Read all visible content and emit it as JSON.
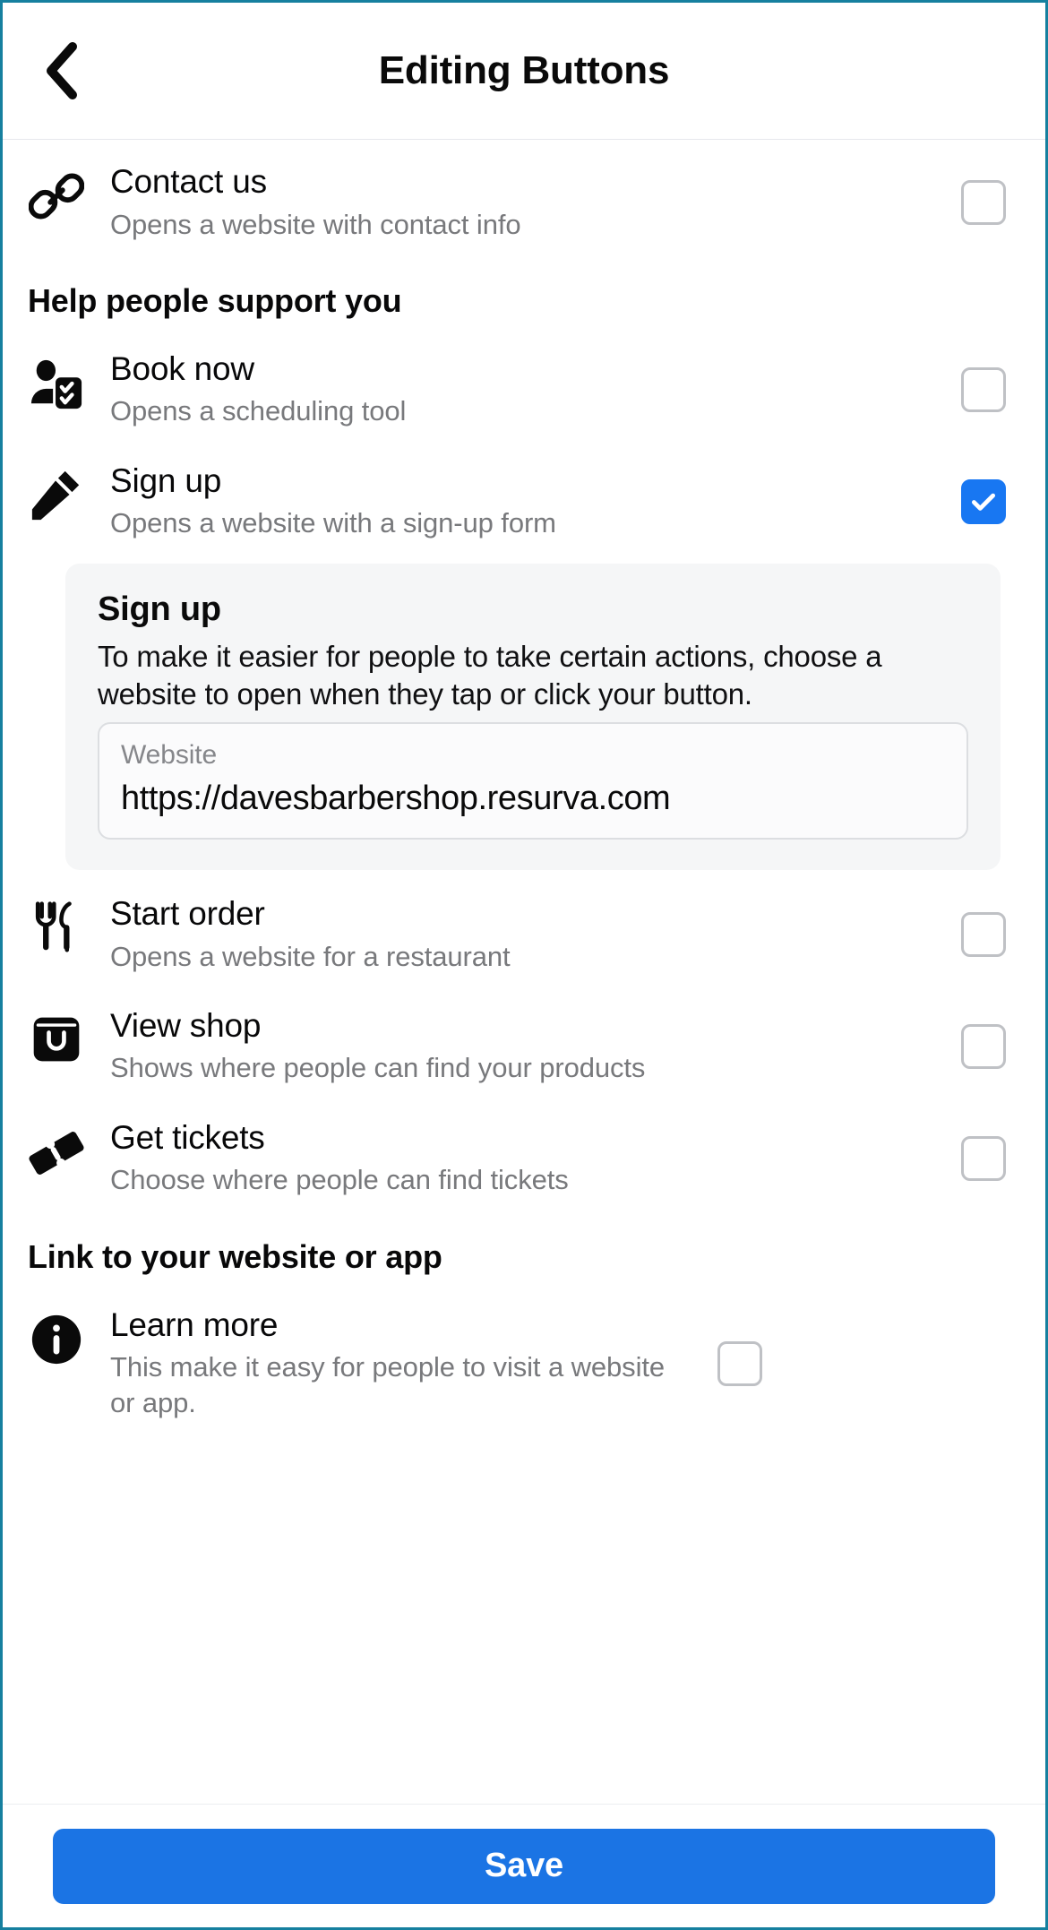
{
  "header": {
    "title": "Editing Buttons",
    "back_icon": "chevron-left-icon"
  },
  "sections": [
    {
      "id": "top-partial",
      "heading": null,
      "rows": [
        {
          "id": "contact-us",
          "icon": "link-icon",
          "title": "Contact us",
          "subtitle": "Opens a website with contact info",
          "checked": false
        }
      ]
    },
    {
      "id": "support",
      "heading": "Help people support you",
      "rows": [
        {
          "id": "book-now",
          "icon": "person-checklist-icon",
          "title": "Book now",
          "subtitle": "Opens a scheduling tool",
          "checked": false
        },
        {
          "id": "sign-up",
          "icon": "pencil-icon",
          "title": "Sign up",
          "subtitle": "Opens a website with a sign-up form",
          "checked": true
        },
        {
          "id": "start-order",
          "icon": "fork-knife-icon",
          "title": "Start order",
          "subtitle": "Opens a website for a restaurant",
          "checked": false
        },
        {
          "id": "view-shop",
          "icon": "shopping-bag-icon",
          "title": "View shop",
          "subtitle": "Shows where people can find your products",
          "checked": false
        },
        {
          "id": "get-tickets",
          "icon": "ticket-icon",
          "title": "Get tickets",
          "subtitle": "Choose where people can find tickets",
          "checked": false
        }
      ]
    },
    {
      "id": "link",
      "heading": "Link to your website or app",
      "rows": [
        {
          "id": "learn-more",
          "icon": "info-circle-icon",
          "title": "Learn more",
          "subtitle": "This make it easy for people to visit a website or app.",
          "checked": false
        }
      ]
    }
  ],
  "expanded_panel": {
    "title": "Sign up",
    "description": "To make it easier for people to take certain actions, choose a website to open when they tap or click your button.",
    "field_label": "Website",
    "field_value": "https://davesbarbershop.resurva.com",
    "field_placeholder": "Website"
  },
  "footer": {
    "save_label": "Save"
  },
  "colors": {
    "accent_blue": "#1b74e4",
    "checkbox_checked": "#1877f2",
    "checkbox_border": "#bfc1c5",
    "panel_bg": "#f5f6f7",
    "subtitle_gray": "#78797c",
    "frame_border": "#16809f"
  }
}
